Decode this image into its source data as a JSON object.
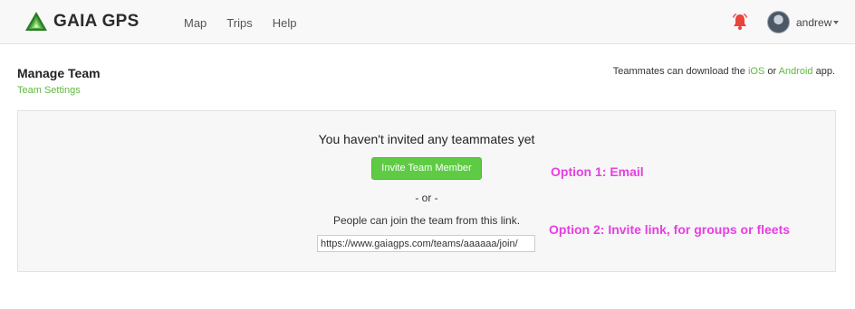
{
  "navbar": {
    "brand": "GAIA GPS",
    "links": [
      "Map",
      "Trips",
      "Help"
    ],
    "user_name": "andrew"
  },
  "page": {
    "title": "Manage Team",
    "settings_link": "Team Settings",
    "download_note": {
      "prefix": "Teammates can download the ",
      "ios": "iOS",
      "middle": " or ",
      "android": "Android",
      "suffix": " app."
    }
  },
  "panel": {
    "empty_message": "You haven't invited any teammates yet",
    "invite_button": "Invite Team Member",
    "or_text": "- or -",
    "join_text": "People can join the team from this link.",
    "join_link": "https://www.gaiagps.com/teams/aaaaaa/join/"
  },
  "annotations": {
    "option1": "Option 1: Email",
    "option2": "Option 2: Invite link, for groups or fleets"
  },
  "colors": {
    "accent_green": "#5fcb45",
    "link_green": "#5fb83f",
    "annotation_magenta": "#e83ee2",
    "bell_red": "#e8453c"
  },
  "icons": {
    "logo": "gaia-mountain-logo",
    "notifications": "bell-icon",
    "user_menu": "chevron-down-icon"
  }
}
